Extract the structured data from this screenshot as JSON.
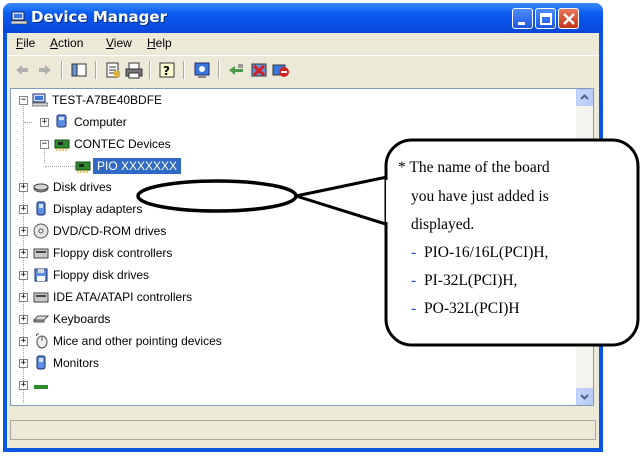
{
  "window": {
    "title": "Device Manager"
  },
  "menu": {
    "file": "File",
    "action": "Action",
    "view": "View",
    "help": "Help",
    "file_key": "F",
    "action_key": "A",
    "view_key": "V",
    "help_key": "H"
  },
  "toolbar": {
    "icons": [
      "back-arrow-icon",
      "forward-arrow-icon",
      "console-tree-icon",
      "properties-icon",
      "print-icon",
      "help-icon",
      "scan-hardware-icon",
      "update-driver-icon",
      "uninstall-icon",
      "disable-device-icon"
    ]
  },
  "tree": {
    "root": "TEST-A7BE40BDFE",
    "items": [
      {
        "label": "Computer",
        "icon": "computer-icon"
      },
      {
        "label": "CONTEC Devices",
        "icon": "board-icon"
      },
      {
        "label": "PIO XXXXXXX",
        "icon": "board-icon"
      },
      {
        "label": "Disk drives",
        "icon": "disk-drive-icon"
      },
      {
        "label": "Display adapters",
        "icon": "display-adapter-icon"
      },
      {
        "label": "DVD/CD-ROM drives",
        "icon": "dvd-drive-icon"
      },
      {
        "label": "Floppy disk controllers",
        "icon": "floppy-controller-icon"
      },
      {
        "label": "Floppy disk drives",
        "icon": "floppy-drive-icon"
      },
      {
        "label": "IDE ATA/ATAPI controllers",
        "icon": "ide-controller-icon"
      },
      {
        "label": "Keyboards",
        "icon": "keyboard-icon"
      },
      {
        "label": "Mice and other pointing devices",
        "icon": "mouse-icon"
      },
      {
        "label": "Monitors",
        "icon": "monitor-icon"
      }
    ],
    "expand_plus": "+",
    "expand_minus": "−"
  },
  "callout": {
    "line1": "* The name of the board",
    "line2": "you have just added is",
    "line3": "displayed.",
    "line4_dash": "-",
    "line4": "PIO-16/16L(PCI)H,",
    "line5_dash": "-",
    "line5": "PI-32L(PCI)H,",
    "line6_dash": "-",
    "line6": "PO-32L(PCI)H"
  },
  "colors": {
    "title_blue": "#0a5cf0",
    "selection": "#316ac5",
    "dash_blue": "#1f3fbf"
  }
}
